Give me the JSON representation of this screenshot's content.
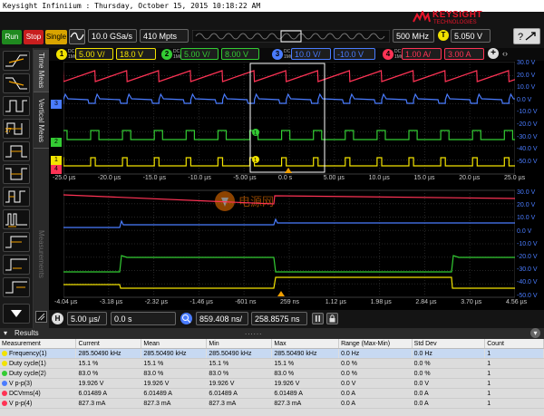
{
  "titlebar": {
    "text": "Keysight Infiniium : Thursday, October 15, 2015 10:18:22 AM"
  },
  "brand": {
    "name": "KEYSIGHT",
    "sub": "TECHNOLOGIES"
  },
  "toolbar": {
    "run_label": "Run",
    "stop_label": "Stop",
    "single_label": "Single",
    "sample_rate": "10.0 GSa/s",
    "memory_depth": "410 Mpts",
    "bandwidth": "500 MHz",
    "trigger_level": "5.050 V"
  },
  "channels": [
    {
      "num": "1",
      "scale": "5.00 V/",
      "offset": "18.0 V",
      "color": "#f2e300"
    },
    {
      "num": "2",
      "scale": "5.00 V/",
      "offset": "8.00 V",
      "color": "#33cc33"
    },
    {
      "num": "3",
      "scale": "10.0 V/",
      "offset": "-10.0 V",
      "color": "#4a7cff"
    },
    {
      "num": "4",
      "scale": "1.00 A/",
      "offset": "3.00 A",
      "color": "#ff3355"
    }
  ],
  "coupling": {
    "dc": "DC",
    "impedance": "1MΩ"
  },
  "tabs": {
    "time_meas": "Time Meas",
    "vertical_meas": "Vertical Meas",
    "measurements": "Measurements"
  },
  "left_tools": {
    "annotation": "17"
  },
  "watermark": "电源网",
  "right_scale": {
    "labels": [
      "30.0 V",
      "20.0 V",
      "10.0 V",
      "0.0 V",
      "-10.0 V",
      "-20.0 V",
      "-30.0 V",
      "-40.0 V",
      "-50.0 V"
    ],
    "labels2": [
      "30.0 V",
      "20.0 V",
      "10.0 V",
      "0.0 V",
      "-10.0 V",
      "-20.0 V",
      "-30.0 V",
      "-40.0 V",
      "-50.0 V"
    ]
  },
  "top_time_labels": [
    "-25.0 µs",
    "-20.0 µs",
    "-15.0 µs",
    "-10.0 µs",
    "-5.00 µs",
    "0.0 s",
    "5.00 µs",
    "10.0 µs",
    "15.0 µs",
    "20.0 µs",
    "25.0 µs"
  ],
  "zoom_time_labels": [
    "-4.04 µs",
    "-3.18 µs",
    "-2.32 µs",
    "-1.46 µs",
    "-601 ns",
    "259 ns",
    "1.12 µs",
    "1.98 µs",
    "2.84 µs",
    "3.70 µs",
    "4.56 µs"
  ],
  "markers": {
    "zoom_window_marker": "1",
    "trigger_marker": "T"
  },
  "bottombar": {
    "h_label": "H",
    "timebase": "5.00 µs/",
    "position": "0.0 s",
    "zoom_scale": "859.408 ns/",
    "zoom_position": "258.8575 ns"
  },
  "results": {
    "title": "Results",
    "headers": [
      "Measurement",
      "Current",
      "Mean",
      "Min",
      "Max",
      "Range (Max-Min)",
      "Std Dev",
      "Count"
    ],
    "rows": [
      {
        "channel_color": "#f2e300",
        "cells": [
          "Frequency(1)",
          "285.50490 kHz",
          "285.50490 kHz",
          "285.50490 kHz",
          "285.50490 kHz",
          "0.0 Hz",
          "0.0 Hz",
          "1"
        ]
      },
      {
        "channel_color": "#f2e300",
        "cells": [
          "Duty cycle(1)",
          "15.1 %",
          "15.1 %",
          "15.1 %",
          "15.1 %",
          "0.0 %",
          "0.0 %",
          "1"
        ]
      },
      {
        "channel_color": "#33cc33",
        "cells": [
          "Duty cycle(2)",
          "83.0 %",
          "83.0 %",
          "83.0 %",
          "83.0 %",
          "0.0 %",
          "0.0 %",
          "1"
        ]
      },
      {
        "channel_color": "#4a7cff",
        "cells": [
          "V p-p(3)",
          "19.926 V",
          "19.926 V",
          "19.926 V",
          "19.926 V",
          "0.0 V",
          "0.0 V",
          "1"
        ]
      },
      {
        "channel_color": "#ff3355",
        "cells": [
          "DCVrms(4)",
          "6.01489 A",
          "6.01489 A",
          "6.01489 A",
          "6.01489 A",
          "0.0 A",
          "0.0 A",
          "1"
        ]
      },
      {
        "channel_color": "#ff3355",
        "cells": [
          "V p-p(4)",
          "827.3 mA",
          "827.3 mA",
          "827.3 mA",
          "827.3 mA",
          "0.0 A",
          "0.0 A",
          "1"
        ]
      }
    ]
  }
}
